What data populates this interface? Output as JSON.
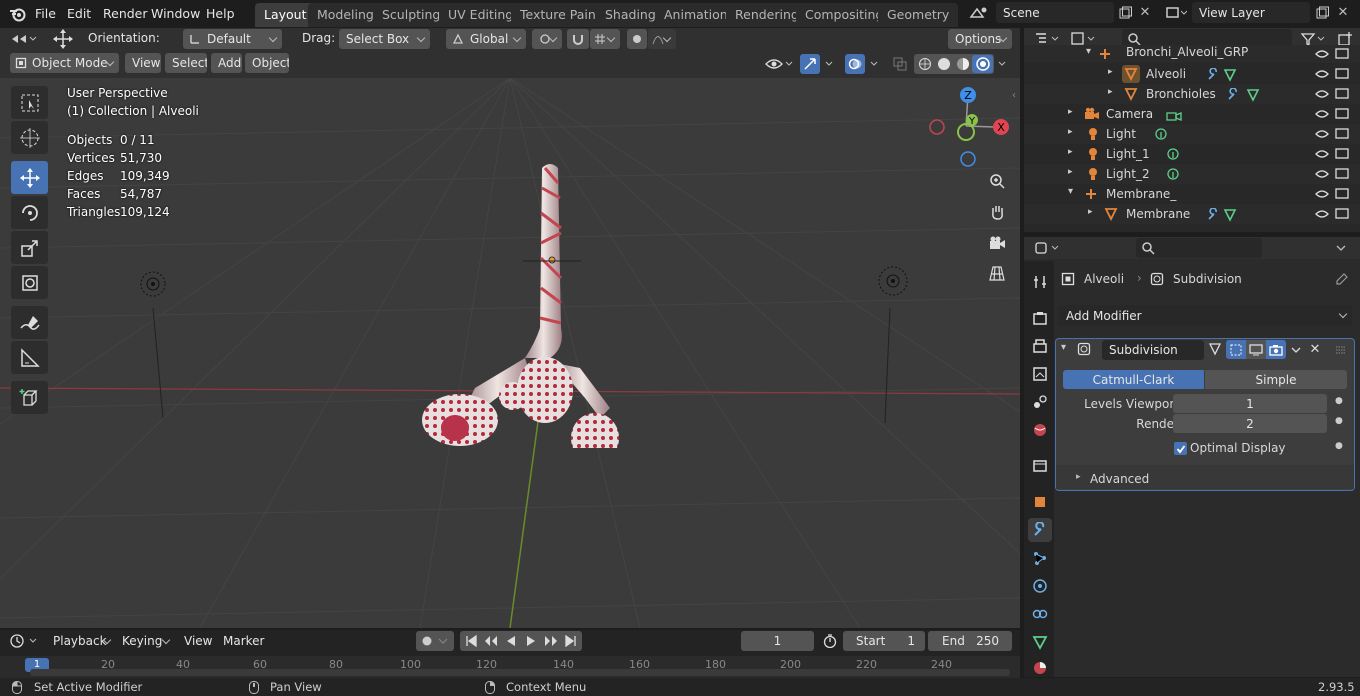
{
  "topbar": {
    "menus": [
      "File",
      "Edit",
      "Render",
      "Window",
      "Help"
    ],
    "workspaces": [
      "Layout",
      "Modeling",
      "Sculpting",
      "UV Editing",
      "Texture Paint",
      "Shading",
      "Animation",
      "Rendering",
      "Compositing",
      "Geometry No"
    ],
    "scene": "Scene",
    "view_layer": "View Layer"
  },
  "header": {
    "orientation_label": "Orientation:",
    "orientation_value": "Default",
    "drag_label": "Drag:",
    "drag_value": "Select Box",
    "transform_value": "Global",
    "options": "Options",
    "mode": "Object Mode",
    "view": "View",
    "select": "Select",
    "add": "Add",
    "object": "Object"
  },
  "viewport": {
    "perspective": "User Perspective",
    "collection": "(1) Collection | Alveoli",
    "stats": [
      {
        "label": "Objects",
        "value": "0 / 11"
      },
      {
        "label": "Vertices",
        "value": "51,730"
      },
      {
        "label": "Edges",
        "value": "109,349"
      },
      {
        "label": "Faces",
        "value": "54,787"
      },
      {
        "label": "Triangles",
        "value": "109,124"
      }
    ],
    "gizmo": {
      "z": "Z",
      "y": "Y",
      "x": "X"
    }
  },
  "outliner": {
    "rows": [
      {
        "label": "Bronchi_Alveoli_GRP",
        "type": "empty"
      },
      {
        "label": "Alveoli",
        "type": "mesh"
      },
      {
        "label": "Bronchioles",
        "type": "mesh"
      },
      {
        "label": "Camera",
        "type": "camera"
      },
      {
        "label": "Light",
        "type": "light"
      },
      {
        "label": "Light_1",
        "type": "light"
      },
      {
        "label": "Light_2",
        "type": "light"
      },
      {
        "label": "Membrane_",
        "type": "empty"
      },
      {
        "label": "Membrane",
        "type": "mesh"
      }
    ]
  },
  "properties": {
    "breadcrumb_object": "Alveoli",
    "breadcrumb_modifier": "Subdivision",
    "add_modifier": "Add Modifier",
    "modifier_name": "Subdivision",
    "type_catmull": "Catmull-Clark",
    "type_simple": "Simple",
    "levels_viewport_label": "Levels Viewport",
    "levels_viewport": "1",
    "render_label": "Render",
    "render": "2",
    "optimal_display": "Optimal Display",
    "advanced": "Advanced"
  },
  "timeline": {
    "playback": "Playback",
    "keying": "Keying",
    "view": "View",
    "marker": "Marker",
    "current_frame": "1",
    "start_label": "Start",
    "start": "1",
    "end_label": "End",
    "end": "250",
    "ruler": [
      "0",
      "20",
      "40",
      "60",
      "80",
      "100",
      "120",
      "140",
      "160",
      "180",
      "200",
      "220",
      "240"
    ]
  },
  "status": {
    "left": "Set Active Modifier",
    "middle": "Pan View",
    "right": "Context Menu",
    "version": "2.93.5"
  },
  "colors": {
    "accent": "#4772b3",
    "orange": "#e3853b",
    "green": "#5ccf8a",
    "x_axis": "#e04552",
    "y_axis": "#8bc34a",
    "z_axis": "#3f8ee8"
  }
}
